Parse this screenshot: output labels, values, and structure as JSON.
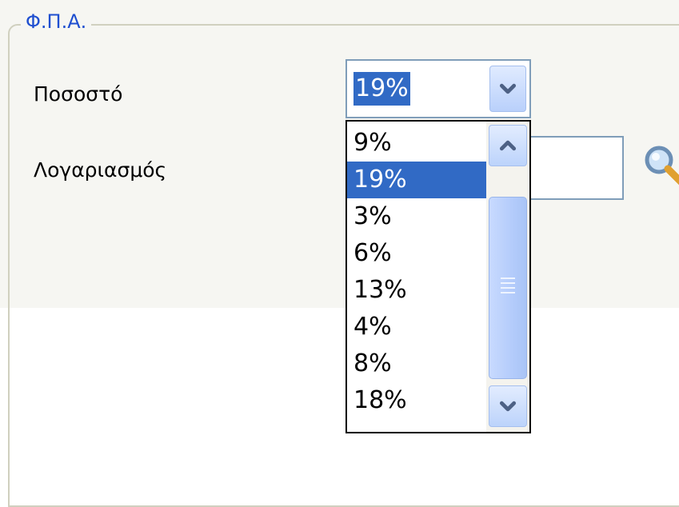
{
  "window": {
    "group_title": "Φ.Π.Α.",
    "rate_label": "Ποσοστό",
    "account_label": "Λογαριασμός"
  },
  "vat_combo": {
    "selected_value": "19%",
    "options": [
      "9%",
      "19%",
      "3%",
      "6%",
      "13%",
      "4%",
      "8%",
      "18%"
    ],
    "highlighted_option": "19%"
  },
  "account_field": {
    "value": ""
  },
  "icons": {
    "dropdown_arrow": "chevron-down-icon",
    "scroll_up": "chevron-up-icon",
    "scroll_down": "chevron-down-icon",
    "lookup": "search-icon"
  },
  "colors": {
    "selection": "#316ac5",
    "group_title": "#1f4fd0",
    "panel_background": "#f6f6f2"
  }
}
